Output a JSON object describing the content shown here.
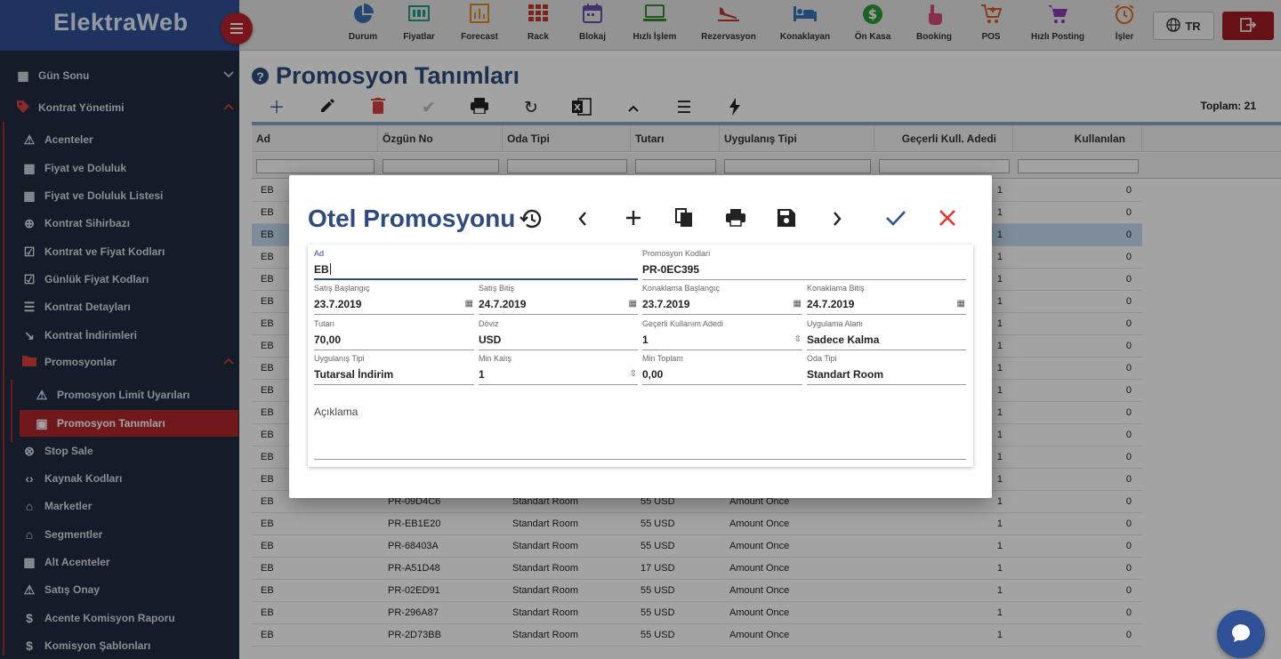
{
  "app": {
    "brand": "ElektraWeb",
    "lang": "TR"
  },
  "topnav": [
    {
      "label": "Durum",
      "icon": "pie-chart-icon",
      "color": "#3b6fb5"
    },
    {
      "label": "Fiyatlar",
      "icon": "price-grid-icon",
      "color": "#1e9a8a"
    },
    {
      "label": "Forecast",
      "icon": "bar-chart-icon",
      "color": "#e08a2a"
    },
    {
      "label": "Rack",
      "icon": "rack-grid-icon",
      "color": "#c0392b"
    },
    {
      "label": "Blokaj",
      "icon": "calendar-icon",
      "color": "#6a4bb0"
    },
    {
      "label": "Hızlı İşlem",
      "icon": "laptop-icon",
      "color": "#2e8b2e"
    },
    {
      "label": "Rezervasyon",
      "icon": "plane-landing-icon",
      "color": "#c0392b"
    },
    {
      "label": "Konaklayan",
      "icon": "bed-icon",
      "color": "#3b6fb5"
    },
    {
      "label": "Ön Kasa",
      "icon": "dollar-coin-icon",
      "color": "#2e9a3a"
    },
    {
      "label": "Booking",
      "icon": "hand-pointer-icon",
      "color": "#d64a7a"
    },
    {
      "label": "POS",
      "icon": "cart-plus-icon",
      "color": "#d65a2a"
    },
    {
      "label": "Hızlı Posting",
      "icon": "cart-icon",
      "color": "#8b3bb5"
    },
    {
      "label": "İşler",
      "icon": "alarm-clock-icon",
      "color": "#e06a1a"
    }
  ],
  "sidebar": {
    "items": [
      {
        "label": "Gün Sonu"
      },
      {
        "label": "Kontrat Yönetimi"
      },
      {
        "label": "Acenteler"
      },
      {
        "label": "Fiyat ve Doluluk"
      },
      {
        "label": "Fiyat ve Doluluk Listesi"
      },
      {
        "label": "Kontrat Sihirbazı"
      },
      {
        "label": "Kontrat ve Fiyat Kodları"
      },
      {
        "label": "Günlük Fiyat Kodları"
      },
      {
        "label": "Kontrat Detayları"
      },
      {
        "label": "Kontrat İndirimleri"
      },
      {
        "label": "Promosyonlar"
      },
      {
        "label": "Promosyon Limit Uyarıları"
      },
      {
        "label": "Promosyon Tanımları"
      },
      {
        "label": "Stop Sale"
      },
      {
        "label": "Kaynak Kodları"
      },
      {
        "label": "Marketler"
      },
      {
        "label": "Segmentler"
      },
      {
        "label": "Alt Acenteler"
      },
      {
        "label": "Satış Onay"
      },
      {
        "label": "Acente Komisyon Raporu"
      },
      {
        "label": "Komisyon Şablonları"
      }
    ]
  },
  "page": {
    "title": "Promosyon Tanımları",
    "total": "Toplam: 21"
  },
  "grid": {
    "columns": [
      "Ad",
      "Özgün No",
      "Oda Tipi",
      "Tutarı",
      "Uygulanış Tipi",
      "Geçerli Kull. Adedi",
      "Kullanılan"
    ],
    "rows": [
      {
        "ad": "EB",
        "no": "",
        "oda": "",
        "tutar": "",
        "tip": "",
        "adet": "1",
        "kul": "0"
      },
      {
        "ad": "EB",
        "no": "",
        "oda": "",
        "tutar": "",
        "tip": "",
        "adet": "1",
        "kul": "0"
      },
      {
        "ad": "EB",
        "no": "",
        "oda": "",
        "tutar": "",
        "tip": "",
        "adet": "1",
        "kul": "0"
      },
      {
        "ad": "EB",
        "no": "",
        "oda": "",
        "tutar": "",
        "tip": "",
        "adet": "1",
        "kul": "0"
      },
      {
        "ad": "EB",
        "no": "",
        "oda": "",
        "tutar": "",
        "tip": "",
        "adet": "1",
        "kul": "0"
      },
      {
        "ad": "EB",
        "no": "",
        "oda": "",
        "tutar": "",
        "tip": "",
        "adet": "1",
        "kul": "0"
      },
      {
        "ad": "EB",
        "no": "",
        "oda": "",
        "tutar": "",
        "tip": "",
        "adet": "1",
        "kul": "0"
      },
      {
        "ad": "EB",
        "no": "",
        "oda": "",
        "tutar": "",
        "tip": "",
        "adet": "1",
        "kul": "0"
      },
      {
        "ad": "EB",
        "no": "",
        "oda": "",
        "tutar": "",
        "tip": "",
        "adet": "1",
        "kul": "0"
      },
      {
        "ad": "EB",
        "no": "",
        "oda": "",
        "tutar": "",
        "tip": "",
        "adet": "1",
        "kul": "0"
      },
      {
        "ad": "EB",
        "no": "",
        "oda": "",
        "tutar": "",
        "tip": "",
        "adet": "1",
        "kul": "0"
      },
      {
        "ad": "EB",
        "no": "",
        "oda": "",
        "tutar": "",
        "tip": "",
        "adet": "1",
        "kul": "0"
      },
      {
        "ad": "EB",
        "no": "",
        "oda": "",
        "tutar": "",
        "tip": "",
        "adet": "1",
        "kul": "0"
      },
      {
        "ad": "EB",
        "no": "",
        "oda": "",
        "tutar": "",
        "tip": "",
        "adet": "1",
        "kul": "0"
      },
      {
        "ad": "EB",
        "no": "PR-09D4C6",
        "oda": "Standart Room",
        "tutar": "55 USD",
        "tip": "Amount Once",
        "adet": "1",
        "kul": "0"
      },
      {
        "ad": "EB",
        "no": "PR-EB1E20",
        "oda": "Standart Room",
        "tutar": "55 USD",
        "tip": "Amount Once",
        "adet": "1",
        "kul": "0"
      },
      {
        "ad": "EB",
        "no": "PR-68403A",
        "oda": "Standart Room",
        "tutar": "55 USD",
        "tip": "Amount Once",
        "adet": "1",
        "kul": "0"
      },
      {
        "ad": "EB",
        "no": "PR-A51D48",
        "oda": "Standart Room",
        "tutar": "17 USD",
        "tip": "Amount Once",
        "adet": "1",
        "kul": "0"
      },
      {
        "ad": "EB",
        "no": "PR-02ED91",
        "oda": "Standart Room",
        "tutar": "55 USD",
        "tip": "Amount Once",
        "adet": "1",
        "kul": "0"
      },
      {
        "ad": "EB",
        "no": "PR-296A87",
        "oda": "Standart Room",
        "tutar": "55 USD",
        "tip": "Amount Once",
        "adet": "1",
        "kul": "0"
      },
      {
        "ad": "EB",
        "no": "PR-2D73BB",
        "oda": "Standart Room",
        "tutar": "55 USD",
        "tip": "Amount Once",
        "adet": "1",
        "kul": "0"
      }
    ]
  },
  "dialog": {
    "title": "Otel Promosyonu",
    "fields": {
      "ad": {
        "label": "Ad",
        "value": "EB"
      },
      "promo_kodlari": {
        "label": "Promosyon Kodları",
        "value": "PR-0EC395"
      },
      "satis_baslangic": {
        "label": "Satış Başlangıç",
        "value": "23.7.2019"
      },
      "satis_bitis": {
        "label": "Satış Bitiş",
        "value": "24.7.2019"
      },
      "konaklama_baslangic": {
        "label": "Konaklama Başlangıç",
        "value": "23.7.2019"
      },
      "konaklama_bitis": {
        "label": "Konaklama Bitiş",
        "value": "24.7.2019"
      },
      "tutari": {
        "label": "Tutarı",
        "value": "70,00"
      },
      "doviz": {
        "label": "Döviz",
        "value": "USD"
      },
      "gecerli_kullanim": {
        "label": "Geçerli Kullanım Adedi",
        "value": "1"
      },
      "uygulama_alani": {
        "label": "Uygulama Alanı",
        "value": "Sadece Kalma"
      },
      "uygulanis_tipi": {
        "label": "Uygulanış Tipi",
        "value": "Tutarsal İndirim"
      },
      "min_kalis": {
        "label": "Min Kalış",
        "value": "1"
      },
      "min_toplam": {
        "label": "Min Toplam",
        "value": "0,00"
      },
      "oda_tipi": {
        "label": "Oda Tipi",
        "value": "Standart Room"
      },
      "aciklama": {
        "label": "Açıklama",
        "value": ""
      }
    }
  },
  "colors": {
    "brand": "#2f5196",
    "accent": "#b0262c",
    "title": "#2f4b7e",
    "sidebar": "#1f2d3f"
  }
}
